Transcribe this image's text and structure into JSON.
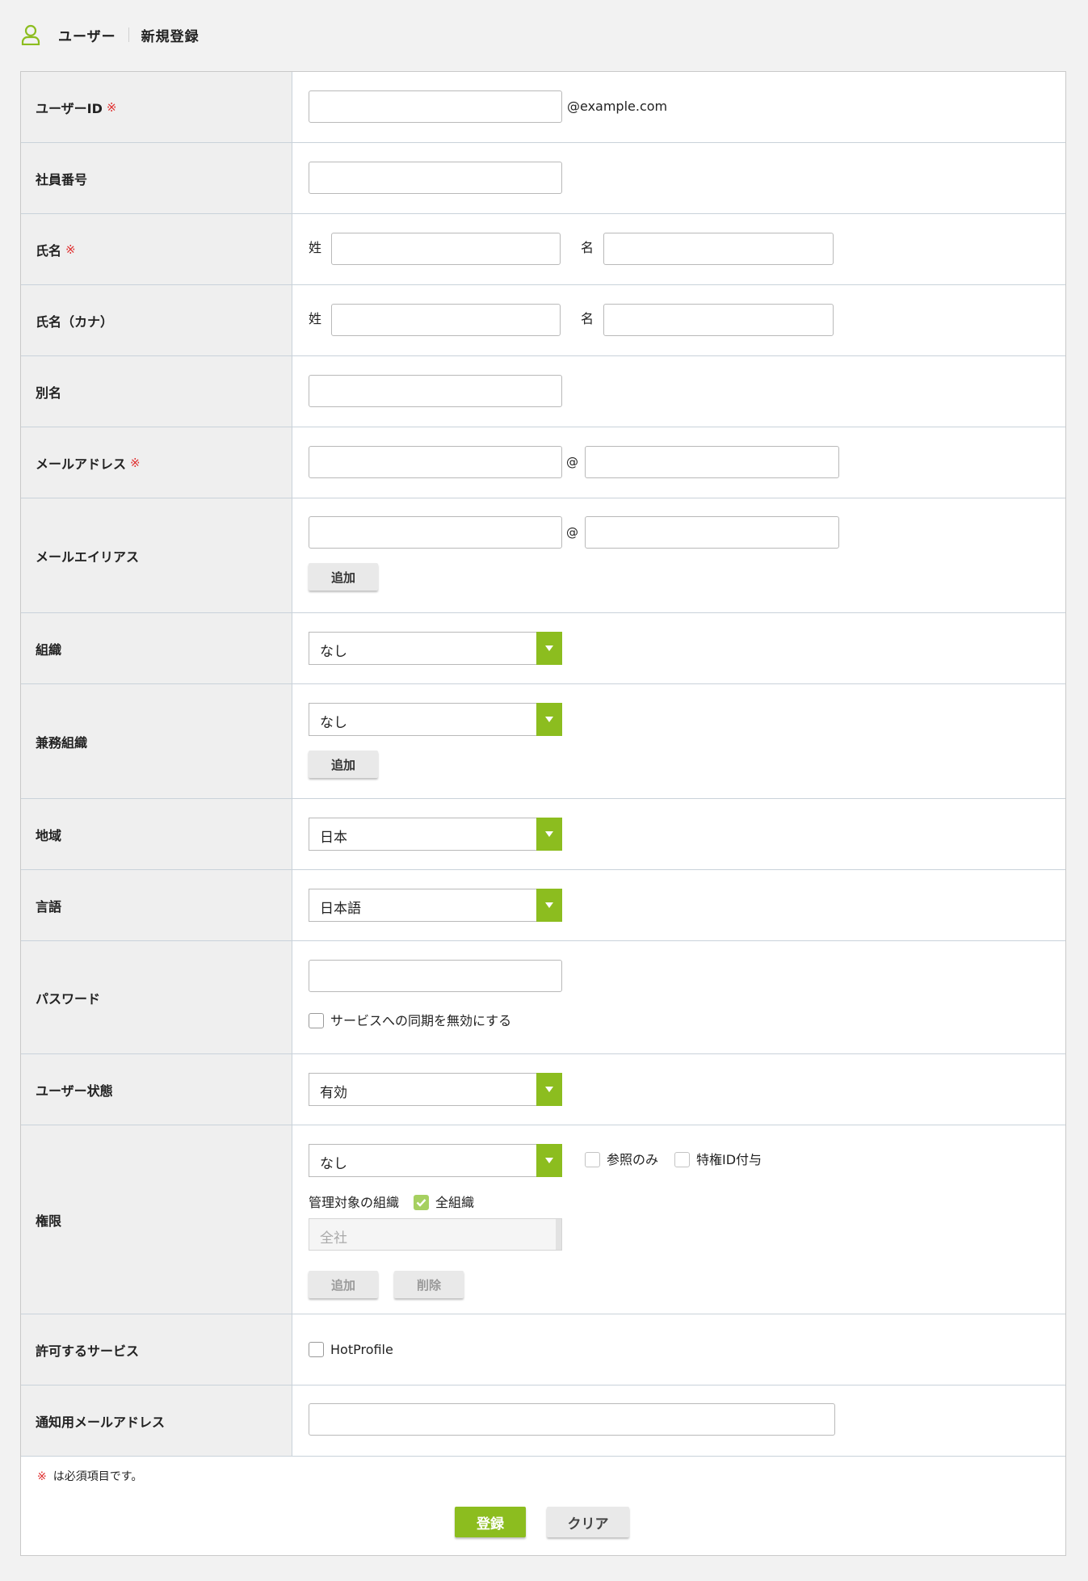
{
  "breadcrumb": {
    "section": "ユーザー",
    "page": "新規登録"
  },
  "required_mark": "※",
  "fields": {
    "user_id": {
      "label": "ユーザーID",
      "domain_suffix": "@example.com"
    },
    "employee_no": {
      "label": "社員番号"
    },
    "name": {
      "label": "氏名",
      "last": "姓",
      "first": "名"
    },
    "name_kana": {
      "label": "氏名（カナ）",
      "last": "姓",
      "first": "名"
    },
    "alias": {
      "label": "別名"
    },
    "email": {
      "label": "メールアドレス",
      "at": "@"
    },
    "email_alias": {
      "label": "メールエイリアス",
      "at": "@",
      "add_button": "追加"
    },
    "org": {
      "label": "組織",
      "value": "なし"
    },
    "concurrent_org": {
      "label": "兼務組織",
      "value": "なし",
      "add_button": "追加"
    },
    "region": {
      "label": "地域",
      "value": "日本"
    },
    "language": {
      "label": "言語",
      "value": "日本語"
    },
    "password": {
      "label": "パスワード",
      "checkbox_label": "サービスへの同期を無効にする"
    },
    "user_status": {
      "label": "ユーザー状態",
      "value": "有効"
    },
    "permission": {
      "label": "権限",
      "value": "なし",
      "readonly_label": "参照のみ",
      "privileged_label": "特権ID付与",
      "managed_org_label": "管理対象の組織",
      "all_orgs_label": "全組織",
      "org_list_value": "全社",
      "add_button": "追加",
      "delete_button": "削除"
    },
    "services": {
      "label": "許可するサービス",
      "service_name": "HotProfile"
    },
    "notify_email": {
      "label": "通知用メールアドレス"
    }
  },
  "footer": {
    "note_mark": "※",
    "note_text": "は必須項目です。",
    "submit": "登録",
    "clear": "クリア"
  },
  "colors": {
    "accent": "#8cbd1f",
    "required": "#e03030"
  }
}
